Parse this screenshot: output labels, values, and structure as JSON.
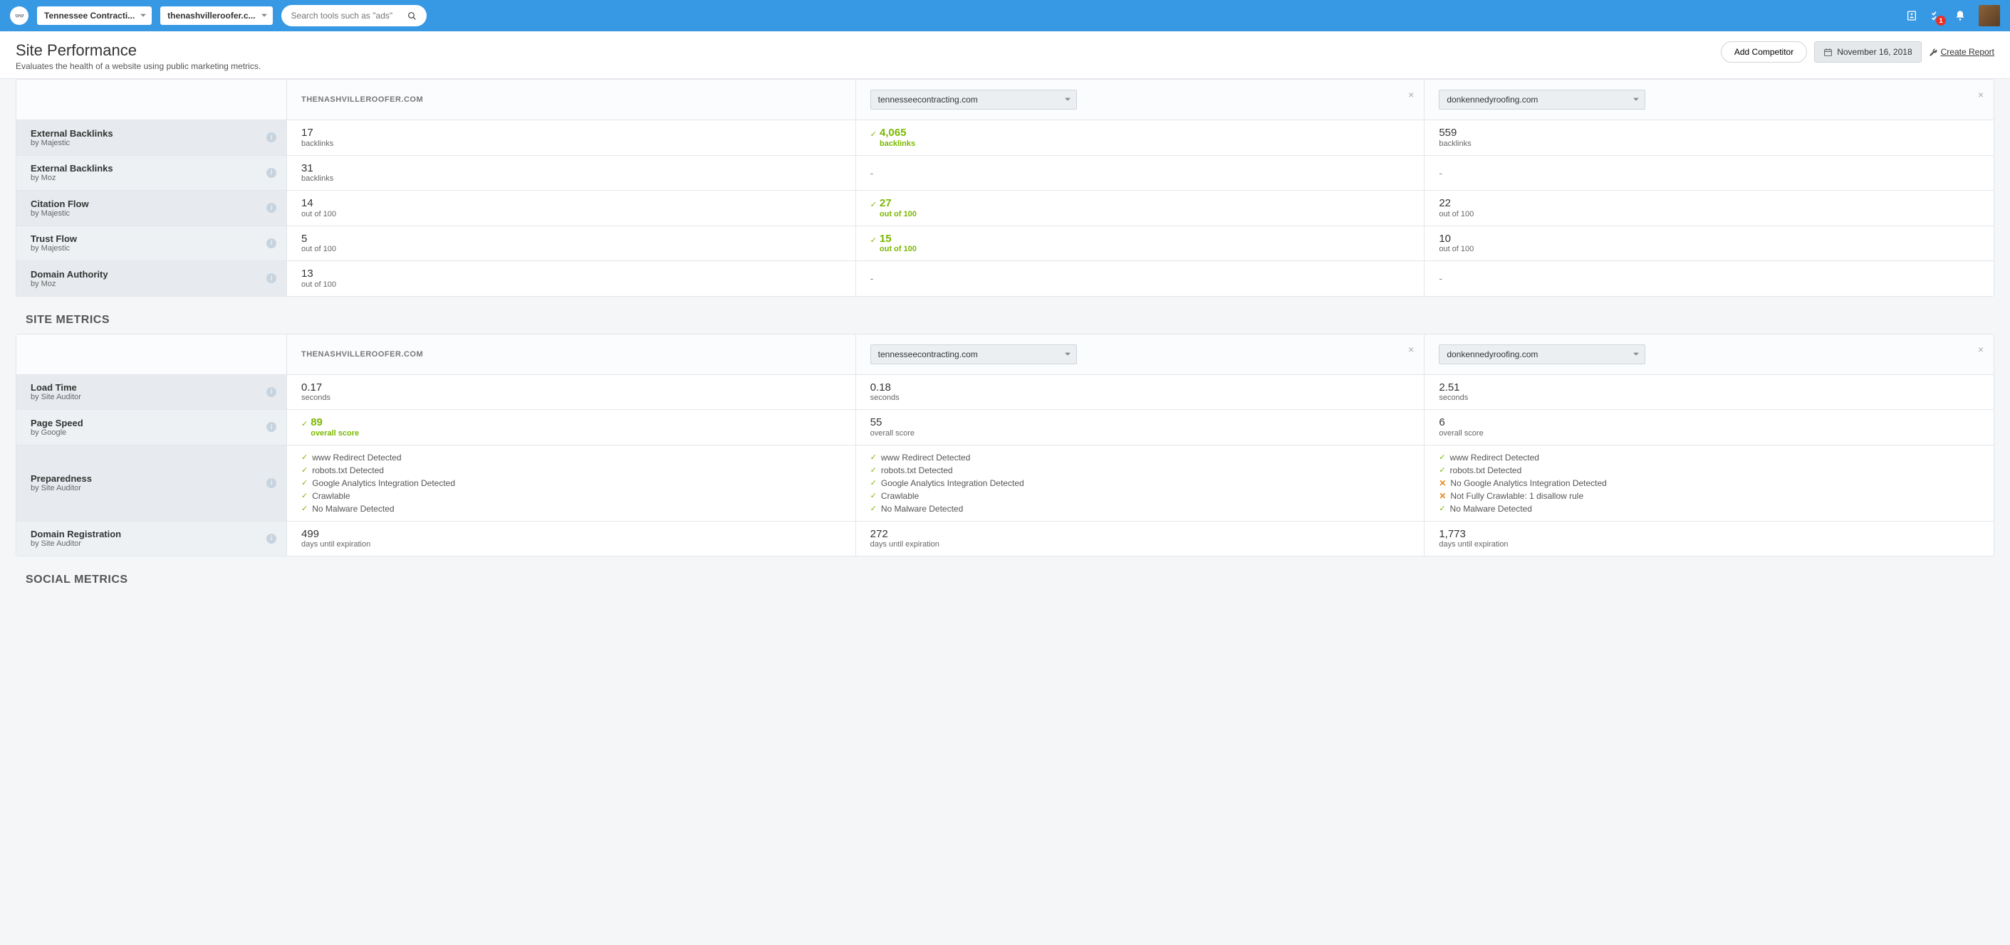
{
  "topbar": {
    "client_dropdown": "Tennessee Contracti...",
    "site_dropdown": "thenashvilleroofer.c...",
    "search_placeholder": "Search tools such as \"ads\"",
    "notif_count": "1"
  },
  "header": {
    "title": "Site Performance",
    "subtitle": "Evaluates the health of a website using public marketing metrics.",
    "add_competitor": "Add Competitor",
    "date": "November 16, 2018",
    "create_report": "Create Report"
  },
  "columns": {
    "own_site": "THENASHVILLEROOFER.COM",
    "comp1": "tennesseecontracting.com",
    "comp2": "donkennedyroofing.com"
  },
  "seo": {
    "rows": [
      {
        "title": "External Backlinks",
        "sub": "by Majestic",
        "own": {
          "main": "17",
          "sub": "backlinks"
        },
        "c1": {
          "main": "4,065",
          "sub": "backlinks",
          "winner": true
        },
        "c2": {
          "main": "559",
          "sub": "backlinks"
        }
      },
      {
        "title": "External Backlinks",
        "sub": "by Moz",
        "own": {
          "main": "31",
          "sub": "backlinks"
        },
        "c1": {
          "dash": true
        },
        "c2": {
          "dash": true
        }
      },
      {
        "title": "Citation Flow",
        "sub": "by Majestic",
        "own": {
          "main": "14",
          "sub": "out of 100"
        },
        "c1": {
          "main": "27",
          "sub": "out of 100",
          "winner": true
        },
        "c2": {
          "main": "22",
          "sub": "out of 100"
        }
      },
      {
        "title": "Trust Flow",
        "sub": "by Majestic",
        "own": {
          "main": "5",
          "sub": "out of 100"
        },
        "c1": {
          "main": "15",
          "sub": "out of 100",
          "winner": true
        },
        "c2": {
          "main": "10",
          "sub": "out of 100"
        }
      },
      {
        "title": "Domain Authority",
        "sub": "by Moz",
        "own": {
          "main": "13",
          "sub": "out of 100"
        },
        "c1": {
          "dash": true
        },
        "c2": {
          "dash": true
        }
      }
    ]
  },
  "site_metrics": {
    "section_title": "SITE METRICS",
    "rows": [
      {
        "title": "Load Time",
        "sub": "by Site Auditor",
        "own": {
          "main": "0.17",
          "sub": "seconds"
        },
        "c1": {
          "main": "0.18",
          "sub": "seconds"
        },
        "c2": {
          "main": "2.51",
          "sub": "seconds"
        }
      },
      {
        "title": "Page Speed",
        "sub": "by Google",
        "own": {
          "main": "89",
          "sub": "overall score",
          "winner": true
        },
        "c1": {
          "main": "55",
          "sub": "overall score"
        },
        "c2": {
          "main": "6",
          "sub": "overall score"
        }
      },
      {
        "title": "Preparedness",
        "sub": "by Site Auditor",
        "prep": true,
        "own": [
          {
            "ok": true,
            "t": "www Redirect Detected"
          },
          {
            "ok": true,
            "t": "robots.txt Detected"
          },
          {
            "ok": true,
            "t": "Google Analytics Integration Detected"
          },
          {
            "ok": true,
            "t": "Crawlable"
          },
          {
            "ok": true,
            "t": "No Malware Detected"
          }
        ],
        "c1": [
          {
            "ok": true,
            "t": "www Redirect Detected"
          },
          {
            "ok": true,
            "t": "robots.txt Detected"
          },
          {
            "ok": true,
            "t": "Google Analytics Integration Detected"
          },
          {
            "ok": true,
            "t": "Crawlable"
          },
          {
            "ok": true,
            "t": "No Malware Detected"
          }
        ],
        "c2": [
          {
            "ok": true,
            "t": "www Redirect Detected"
          },
          {
            "ok": true,
            "t": "robots.txt Detected"
          },
          {
            "ok": false,
            "t": "No Google Analytics Integration Detected"
          },
          {
            "ok": false,
            "t": "Not Fully Crawlable: 1 disallow rule"
          },
          {
            "ok": true,
            "t": "No Malware Detected"
          }
        ]
      },
      {
        "title": "Domain Registration",
        "sub": "by Site Auditor",
        "own": {
          "main": "499",
          "sub": "days until expiration"
        },
        "c1": {
          "main": "272",
          "sub": "days until expiration"
        },
        "c2": {
          "main": "1,773",
          "sub": "days until expiration"
        }
      }
    ]
  },
  "social": {
    "section_title": "SOCIAL METRICS"
  }
}
